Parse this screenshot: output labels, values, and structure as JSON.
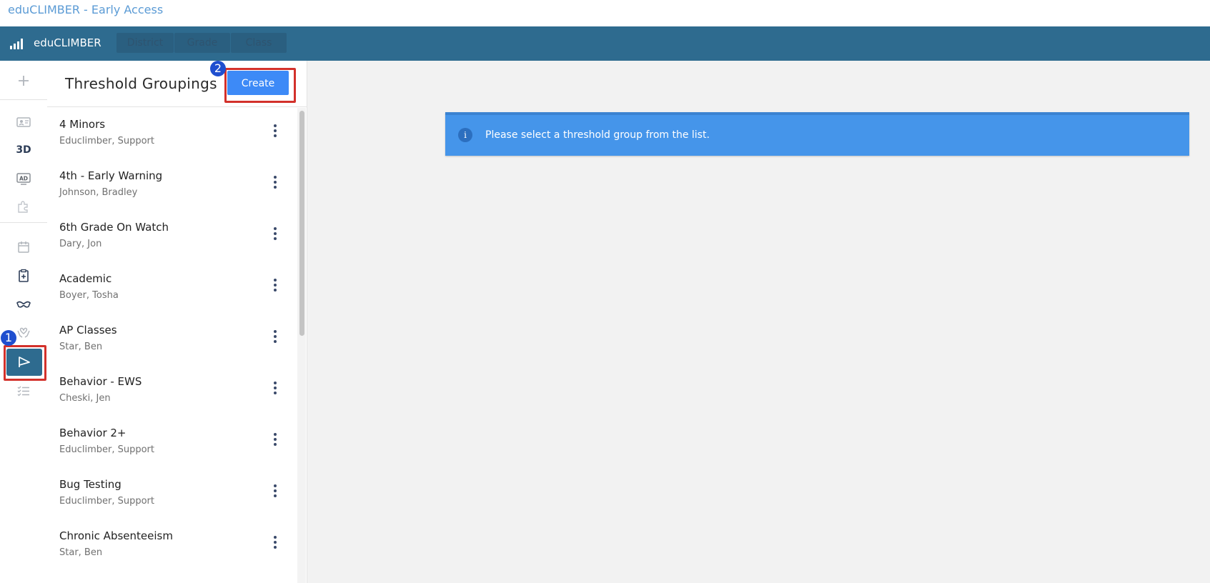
{
  "window": {
    "title": "eduCLIMBER - Early Access"
  },
  "topbar": {
    "app_name": "eduCLIMBER",
    "breadcrumbs": [
      "District",
      "Grade",
      "Class"
    ]
  },
  "rail": {
    "label_3d": "3D",
    "icons": [
      "plus-icon",
      "id-card-icon",
      "3d-label",
      "ad-icon",
      "puzzle-icon",
      "calendar-icon",
      "clipboard-icon",
      "goggles-icon",
      "hands-heart-icon",
      "flag-icon",
      "checklist-icon"
    ]
  },
  "annotations": {
    "badge_1": "1",
    "badge_2": "2",
    "highlight_color": "#d3312b"
  },
  "list": {
    "title": "Threshold Groupings",
    "create_label": "Create",
    "items": [
      {
        "name": "4 Minors",
        "owner": "Educlimber, Support"
      },
      {
        "name": "4th - Early Warning",
        "owner": "Johnson, Bradley"
      },
      {
        "name": "6th Grade On Watch",
        "owner": "Dary, Jon"
      },
      {
        "name": "Academic",
        "owner": "Boyer, Tosha"
      },
      {
        "name": "AP Classes",
        "owner": "Star, Ben"
      },
      {
        "name": "Behavior - EWS",
        "owner": "Cheski, Jen"
      },
      {
        "name": "Behavior 2+",
        "owner": "Educlimber, Support"
      },
      {
        "name": "Bug Testing",
        "owner": "Educlimber, Support"
      },
      {
        "name": "Chronic Absenteeism",
        "owner": "Star, Ben"
      }
    ]
  },
  "main": {
    "alert_message": "Please select a threshold group from the list."
  },
  "colors": {
    "topbar": "#2e6b8f",
    "create_button": "#3d8af7",
    "alert": "#4595ea",
    "main_bg": "#f2f2f2"
  }
}
